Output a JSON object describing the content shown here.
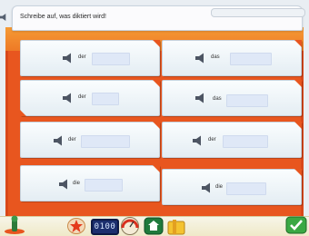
{
  "instruction": {
    "text": "Schreibe auf, was diktiert wird!"
  },
  "cards": [
    {
      "article": "der",
      "answer": ""
    },
    {
      "article": "das",
      "answer": ""
    },
    {
      "article": "der",
      "answer": ""
    },
    {
      "article": "das",
      "answer": ""
    },
    {
      "article": "der",
      "answer": ""
    },
    {
      "article": "der",
      "answer": ""
    },
    {
      "article": "die",
      "answer": ""
    },
    {
      "article": "die",
      "answer": ""
    }
  ],
  "toolbar": {
    "clock": "0100",
    "icons": [
      "figure-icon",
      "star-icon",
      "clock-icon",
      "gauge-icon",
      "house-icon",
      "folder-icon",
      "check-icon"
    ]
  },
  "colors": {
    "background_orange": "#e8561f",
    "answer_field": "#dfe8f7",
    "clock_bg": "#1c2f6e"
  }
}
